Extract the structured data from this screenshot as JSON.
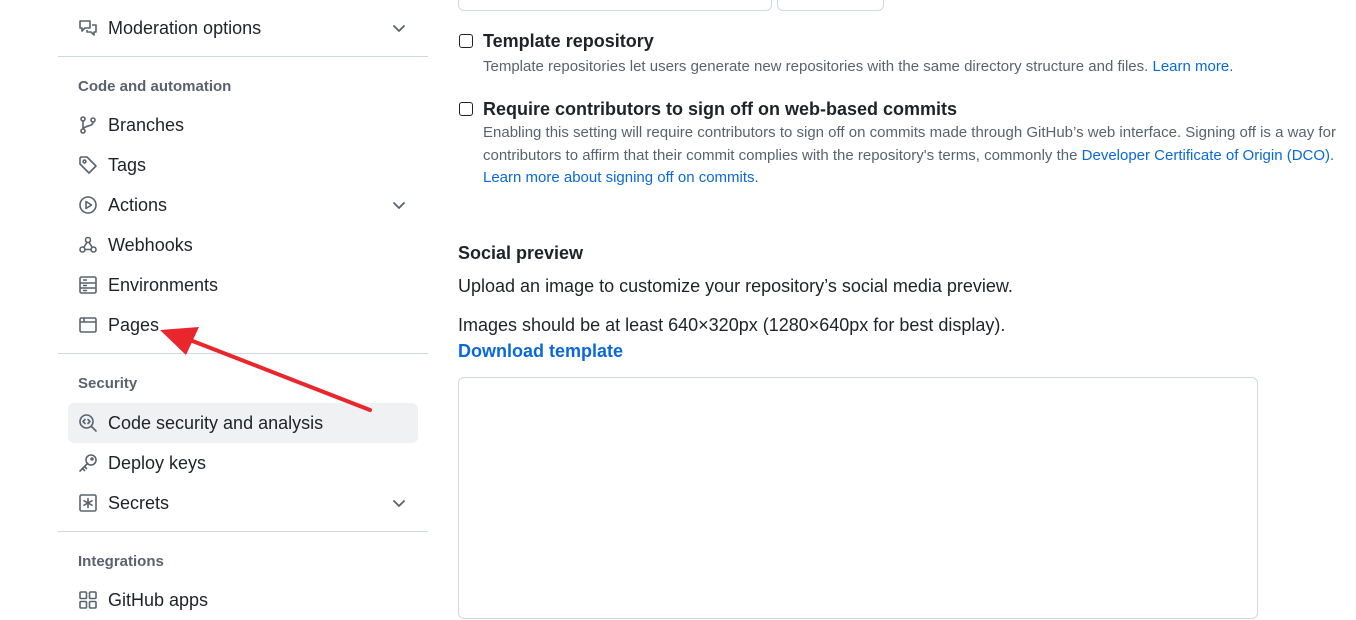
{
  "sidebar": {
    "items": [
      {
        "label": "Moderation options",
        "icon": "comment-discussion-icon",
        "expandable": true
      },
      {
        "label": "Branches",
        "icon": "git-branch-icon"
      },
      {
        "label": "Tags",
        "icon": "tag-icon"
      },
      {
        "label": "Actions",
        "icon": "play-icon",
        "expandable": true
      },
      {
        "label": "Webhooks",
        "icon": "webhook-icon"
      },
      {
        "label": "Environments",
        "icon": "server-icon"
      },
      {
        "label": "Pages",
        "icon": "browser-icon"
      },
      {
        "label": "Code security and analysis",
        "icon": "codescan-icon",
        "active": true
      },
      {
        "label": "Deploy keys",
        "icon": "key-icon"
      },
      {
        "label": "Secrets",
        "icon": "key-asterisk-icon",
        "expandable": true
      },
      {
        "label": "GitHub apps",
        "icon": "apps-icon"
      }
    ],
    "sections": {
      "code_automation": "Code and automation",
      "security": "Security",
      "integrations": "Integrations"
    }
  },
  "main": {
    "template_repo": {
      "title": "Template repository",
      "desc": "Template repositories let users generate new repositories with the same directory structure and files.",
      "link": "Learn more."
    },
    "signoff": {
      "title": "Require contributors to sign off on web-based commits",
      "desc_1": "Enabling this setting will require contributors to sign off on commits made through GitHub’s web interface. Signing off is a way for contributors to affirm that their commit complies with the repository's terms, commonly the",
      "link_dco": "Developer Certificate of Origin (DCO).",
      "link_more": "Learn more about signing off on commits."
    },
    "social": {
      "heading": "Social preview",
      "upload_text": "Upload an image to customize your repository’s social media preview.",
      "size_text": "Images should be at least 640×320px (1280×640px for best display).",
      "download_link": "Download template"
    }
  },
  "colors": {
    "link": "#0969da",
    "muted": "#59636e",
    "active_bg": "#eff1f3",
    "annotation_arrow": "#e8262b"
  }
}
